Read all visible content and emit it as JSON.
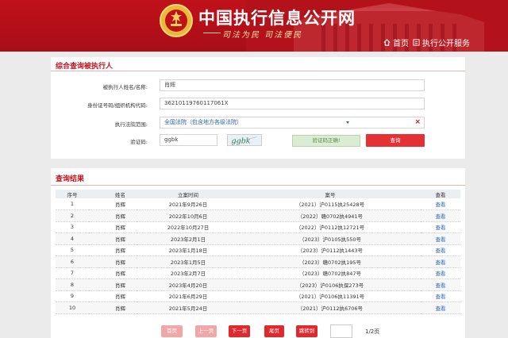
{
  "header": {
    "site_title": "中国执行信息公开网",
    "slogan": "司法为民  司法便民",
    "nav_home": "首页",
    "nav_service": "执行公开服务"
  },
  "query": {
    "title": "综合查询被执行人",
    "name_label": "被执行人姓名/名称:",
    "name_value": "肖辉",
    "id_label": "身份证号码/组织机构代码:",
    "id_value": "36210119760117061X",
    "court_label": "执行法院范围:",
    "court_value": "全国法院（包含地方各级法院）",
    "captcha_label": "验证码:",
    "captcha_value": "ggbk",
    "captcha_image_text": "ggbk",
    "verify_status": "验证码正确!",
    "query_button": "查询"
  },
  "results": {
    "title": "查询结果",
    "columns": [
      "序号",
      "姓名",
      "立案时间",
      "案号",
      "查看"
    ],
    "rows": [
      {
        "no": "1",
        "name": "肖辉",
        "date": "2021年9月26日",
        "case": "（2021）沪0115执25428号",
        "view": "查看"
      },
      {
        "no": "2",
        "name": "肖辉",
        "date": "2022年10月6日",
        "case": "（2022）赣0702执4941号",
        "view": "查看"
      },
      {
        "no": "3",
        "name": "肖辉",
        "date": "2022年10月27日",
        "case": "（2022）沪0112执12721号",
        "view": "查看"
      },
      {
        "no": "4",
        "name": "肖辉",
        "date": "2023年2月1日",
        "case": "（2023）沪0105执550号",
        "view": "查看"
      },
      {
        "no": "5",
        "name": "肖辉",
        "date": "2023年1月18日",
        "case": "（2023）沪0112执1443号",
        "view": "查看"
      },
      {
        "no": "6",
        "name": "肖辉",
        "date": "2023年1月5日",
        "case": "（2023）赣0702执195号",
        "view": "查看"
      },
      {
        "no": "7",
        "name": "肖辉",
        "date": "2023年2月7日",
        "case": "（2023）赣0702执847号",
        "view": "查看"
      },
      {
        "no": "8",
        "name": "肖辉",
        "date": "2023年4月20日",
        "case": "（2023）沪0106执保273号",
        "view": "查看"
      },
      {
        "no": "9",
        "name": "肖辉",
        "date": "2021年6月29日",
        "case": "（2021）沪0106执11391号",
        "view": "查看"
      },
      {
        "no": "10",
        "name": "肖辉",
        "date": "2021年5月24日",
        "case": "（2021）沪0112执6706号",
        "view": "查看"
      }
    ]
  },
  "pager": {
    "first": "首页",
    "prev": "上一页",
    "next": "下一页",
    "last": "尾页",
    "jump": "跳转到",
    "page_input": "",
    "page_count": "1/2页"
  },
  "colors": {
    "header_red": "#c0111b",
    "accent_red": "#e33134",
    "link_blue": "#2f64b8",
    "success_green": "#5d8a47"
  }
}
